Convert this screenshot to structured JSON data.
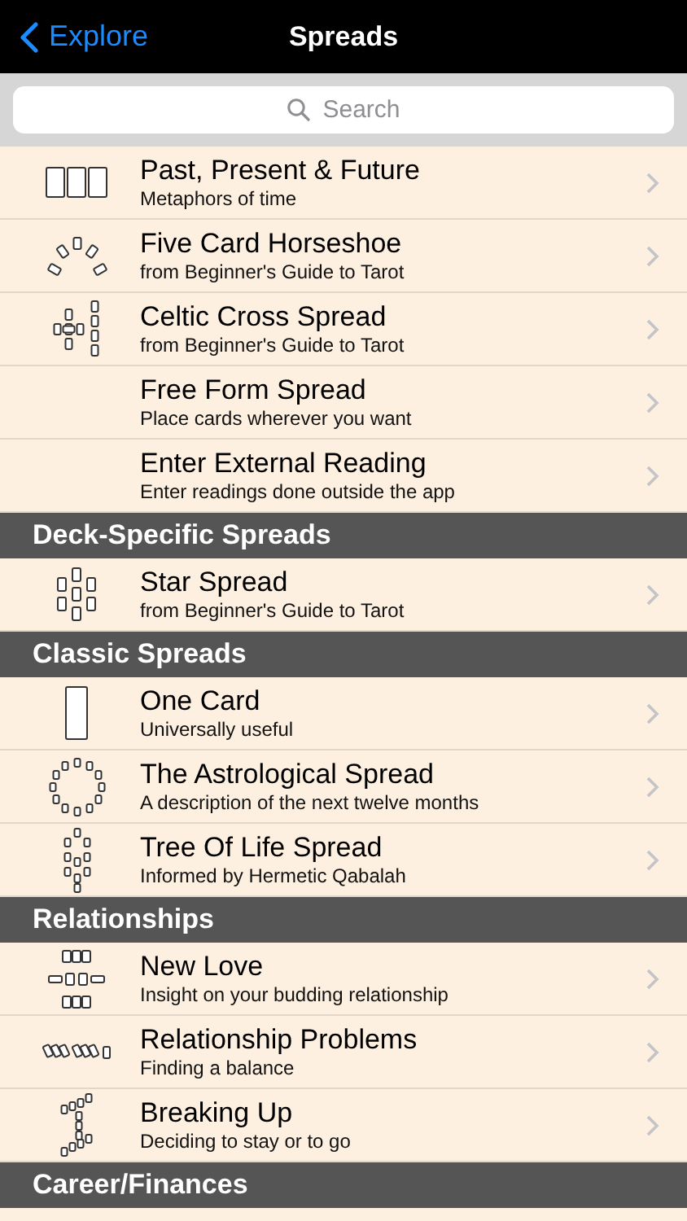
{
  "nav": {
    "back": "Explore",
    "title": "Spreads"
  },
  "search": {
    "placeholder": "Search"
  },
  "sections": [
    {
      "items": [
        {
          "kind": "three",
          "title": "Past, Present & Future",
          "subtitle": "Metaphors of time"
        },
        {
          "kind": "horseshoe",
          "title": "Five Card Horseshoe",
          "subtitle": "from Beginner's Guide to Tarot"
        },
        {
          "kind": "celtic",
          "title": "Celtic Cross Spread",
          "subtitle": "from Beginner's Guide to Tarot"
        },
        {
          "kind": "plain",
          "title": "Free Form Spread",
          "subtitle": "Place cards wherever you want"
        },
        {
          "kind": "plain",
          "title": "Enter External Reading",
          "subtitle": "Enter readings done outside the app"
        }
      ]
    },
    {
      "header": "Deck-Specific Spreads",
      "items": [
        {
          "kind": "star",
          "title": "Star Spread",
          "subtitle": "from Beginner's Guide to Tarot"
        }
      ]
    },
    {
      "header": "Classic Spreads",
      "items": [
        {
          "kind": "one",
          "title": "One Card",
          "subtitle": "Universally useful"
        },
        {
          "kind": "astro",
          "title": "The Astrological Spread",
          "subtitle": "A description of the next twelve months"
        },
        {
          "kind": "tree",
          "title": "Tree Of Life Spread",
          "subtitle": "Informed by Hermetic Qabalah"
        }
      ]
    },
    {
      "header": "Relationships",
      "items": [
        {
          "kind": "newlove",
          "title": "New Love",
          "subtitle": "Insight on your budding relationship"
        },
        {
          "kind": "pairs",
          "title": "Relationship Problems",
          "subtitle": "Finding a balance"
        },
        {
          "kind": "stairs",
          "title": "Breaking Up",
          "subtitle": "Deciding to stay or to go"
        }
      ]
    },
    {
      "header": "Career/Finances"
    }
  ]
}
